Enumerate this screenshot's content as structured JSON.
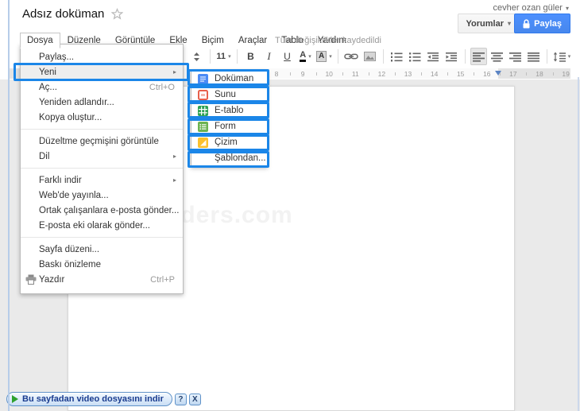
{
  "header": {
    "title": "Adsız doküman",
    "user_name": "cevher ozan güler",
    "comments_label": "Yorumlar",
    "share_label": "Paylaş",
    "save_status": "Tüm değişiklikler kaydedildi"
  },
  "menubar": {
    "items": [
      "Dosya",
      "Düzenle",
      "Görüntüle",
      "Ekle",
      "Biçim",
      "Araçlar",
      "Tablo",
      "Yardım"
    ],
    "active": "Dosya"
  },
  "file_menu": {
    "items": [
      {
        "label": "Paylaş..."
      },
      {
        "label": "Yeni",
        "submenu": true,
        "hover": true,
        "annotated": true
      },
      {
        "label": "Aç...",
        "shortcut": "Ctrl+O"
      },
      {
        "label": "Yeniden adlandır..."
      },
      {
        "label": "Kopya oluştur..."
      },
      {
        "divider": true
      },
      {
        "label": "Düzeltme geçmişini görüntüle"
      },
      {
        "label": "Dil",
        "submenu": true
      },
      {
        "divider": true
      },
      {
        "label": "Farklı indir",
        "submenu": true
      },
      {
        "label": "Web'de yayınla..."
      },
      {
        "label": "Ortak çalışanlara e-posta gönder..."
      },
      {
        "label": "E-posta eki olarak gönder..."
      },
      {
        "divider": true
      },
      {
        "label": "Sayfa düzeni..."
      },
      {
        "label": "Baskı önizleme"
      },
      {
        "label": "Yazdır",
        "shortcut": "Ctrl+P",
        "icon": "printer"
      }
    ]
  },
  "new_submenu": {
    "items": [
      {
        "label": "Doküman",
        "icon": "docs",
        "color": "#4b8bf5",
        "annotated": true
      },
      {
        "label": "Sunu",
        "icon": "slides",
        "color": "#e8604c",
        "annotated": true
      },
      {
        "label": "E-tablo",
        "icon": "sheets",
        "color": "#2da154",
        "annotated": true
      },
      {
        "label": "Form",
        "icon": "forms",
        "color": "#6cb351",
        "annotated": true
      },
      {
        "label": "Çizim",
        "icon": "drawing",
        "color": "#fbc02d",
        "annotated": true
      },
      {
        "label": "Şablondan...",
        "annotated": true
      }
    ]
  },
  "toolbar": {
    "items": [
      {
        "name": "font-size-stepper",
        "type": "icon",
        "icon": "stepper"
      },
      {
        "type": "sep"
      },
      {
        "name": "font-size-select",
        "type": "text",
        "label": "11",
        "cls": "tb-size",
        "dropdown": true
      },
      {
        "type": "sep"
      },
      {
        "name": "bold-button",
        "type": "text",
        "label": "B",
        "cls": "tb-b"
      },
      {
        "name": "italic-button",
        "type": "text",
        "label": "I",
        "cls": "tb-i"
      },
      {
        "name": "underline-button",
        "type": "text",
        "label": "U",
        "cls": "tb-u"
      },
      {
        "name": "text-color-button",
        "type": "text",
        "label": "A",
        "cls": "tb-color-a",
        "dropdown": true
      },
      {
        "name": "highlight-color-button",
        "type": "text",
        "label": "A",
        "cls": "tb-hl-a",
        "dropdown": true
      },
      {
        "type": "sep"
      },
      {
        "name": "insert-link-button",
        "type": "icon",
        "icon": "link"
      },
      {
        "name": "insert-image-button",
        "type": "icon",
        "icon": "image"
      },
      {
        "type": "sep"
      },
      {
        "name": "numbered-list-button",
        "type": "icon",
        "icon": "ol"
      },
      {
        "name": "bulleted-list-button",
        "type": "icon",
        "icon": "ul"
      },
      {
        "name": "decrease-indent-button",
        "type": "icon",
        "icon": "outdent"
      },
      {
        "name": "increase-indent-button",
        "type": "icon",
        "icon": "indent"
      },
      {
        "type": "sep"
      },
      {
        "name": "align-left-button",
        "type": "icon",
        "icon": "align-left",
        "active": true
      },
      {
        "name": "align-center-button",
        "type": "icon",
        "icon": "align-center"
      },
      {
        "name": "align-right-button",
        "type": "icon",
        "icon": "align-right"
      },
      {
        "name": "align-justify-button",
        "type": "icon",
        "icon": "align-justify"
      },
      {
        "type": "sep"
      },
      {
        "name": "line-spacing-button",
        "type": "icon",
        "icon": "line-spacing",
        "dropdown": true
      }
    ]
  },
  "ruler": {
    "numbers": [
      "8",
      "9",
      "10",
      "11",
      "12",
      "13",
      "14",
      "15",
      "16",
      "17",
      "18",
      "19"
    ]
  },
  "document": {
    "watermark": "dijitalders.com"
  },
  "download_bar": {
    "label": "Bu sayfadan video dosyasını indir",
    "help_label": "?",
    "close_label": "X"
  },
  "colors": {
    "annotation_blue": "#1b86e8",
    "share_blue": "#4d90fe"
  }
}
